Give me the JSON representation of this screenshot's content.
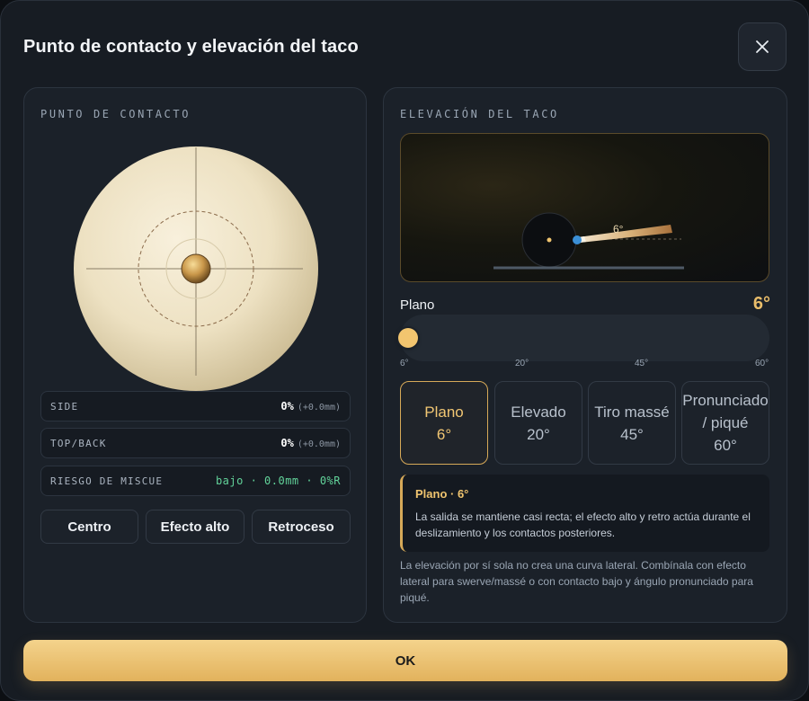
{
  "dialog": {
    "title": "Punto de contacto y elevación del taco",
    "ok_label": "OK"
  },
  "contact": {
    "section_label": "PUNTO DE CONTACTO",
    "side": {
      "label": "SIDE",
      "value": "0%",
      "detail": "(+0.0mm)"
    },
    "topback": {
      "label": "TOP/BACK",
      "value": "0%",
      "detail": "(+0.0mm)"
    },
    "miscue": {
      "label": "RIESGO DE MISCUE",
      "value": "bajo · 0.0mm · 0%R"
    },
    "buttons": [
      "Centro",
      "Efecto alto",
      "Retroceso"
    ]
  },
  "elevation": {
    "section_label": "ELEVACIÓN DEL TACO",
    "preview_angle": "6°",
    "current_mode": "Plano",
    "current_value": "6°",
    "slider": {
      "min": 6,
      "max": 60,
      "value": 6,
      "ticks": [
        "6°",
        "20°",
        "45°",
        "60°"
      ]
    },
    "options": [
      {
        "name": "Plano",
        "value": "6°",
        "active": true
      },
      {
        "name": "Elevado",
        "value": "20°",
        "active": false
      },
      {
        "name": "Tiro massé",
        "value": "45°",
        "active": false
      },
      {
        "name": "Pronunciado / piqué",
        "value": "60°",
        "active": false
      }
    ],
    "info_title": "Plano · 6°",
    "info_text": "La salida se mantiene casi recta; el efecto alto y retro actúa durante el deslizamiento y los contactos posteriores.",
    "note": "La elevación por sí sola no crea una curva lateral. Combínala con efecto lateral para swerve/massé o con contacto bajo y ángulo pronunciado para piqué."
  },
  "colors": {
    "accent": "#e9bd6a",
    "risk_low": "#62d39a",
    "cue_tip": "#3b8fd6"
  },
  "icons": {
    "close": "close-icon"
  }
}
